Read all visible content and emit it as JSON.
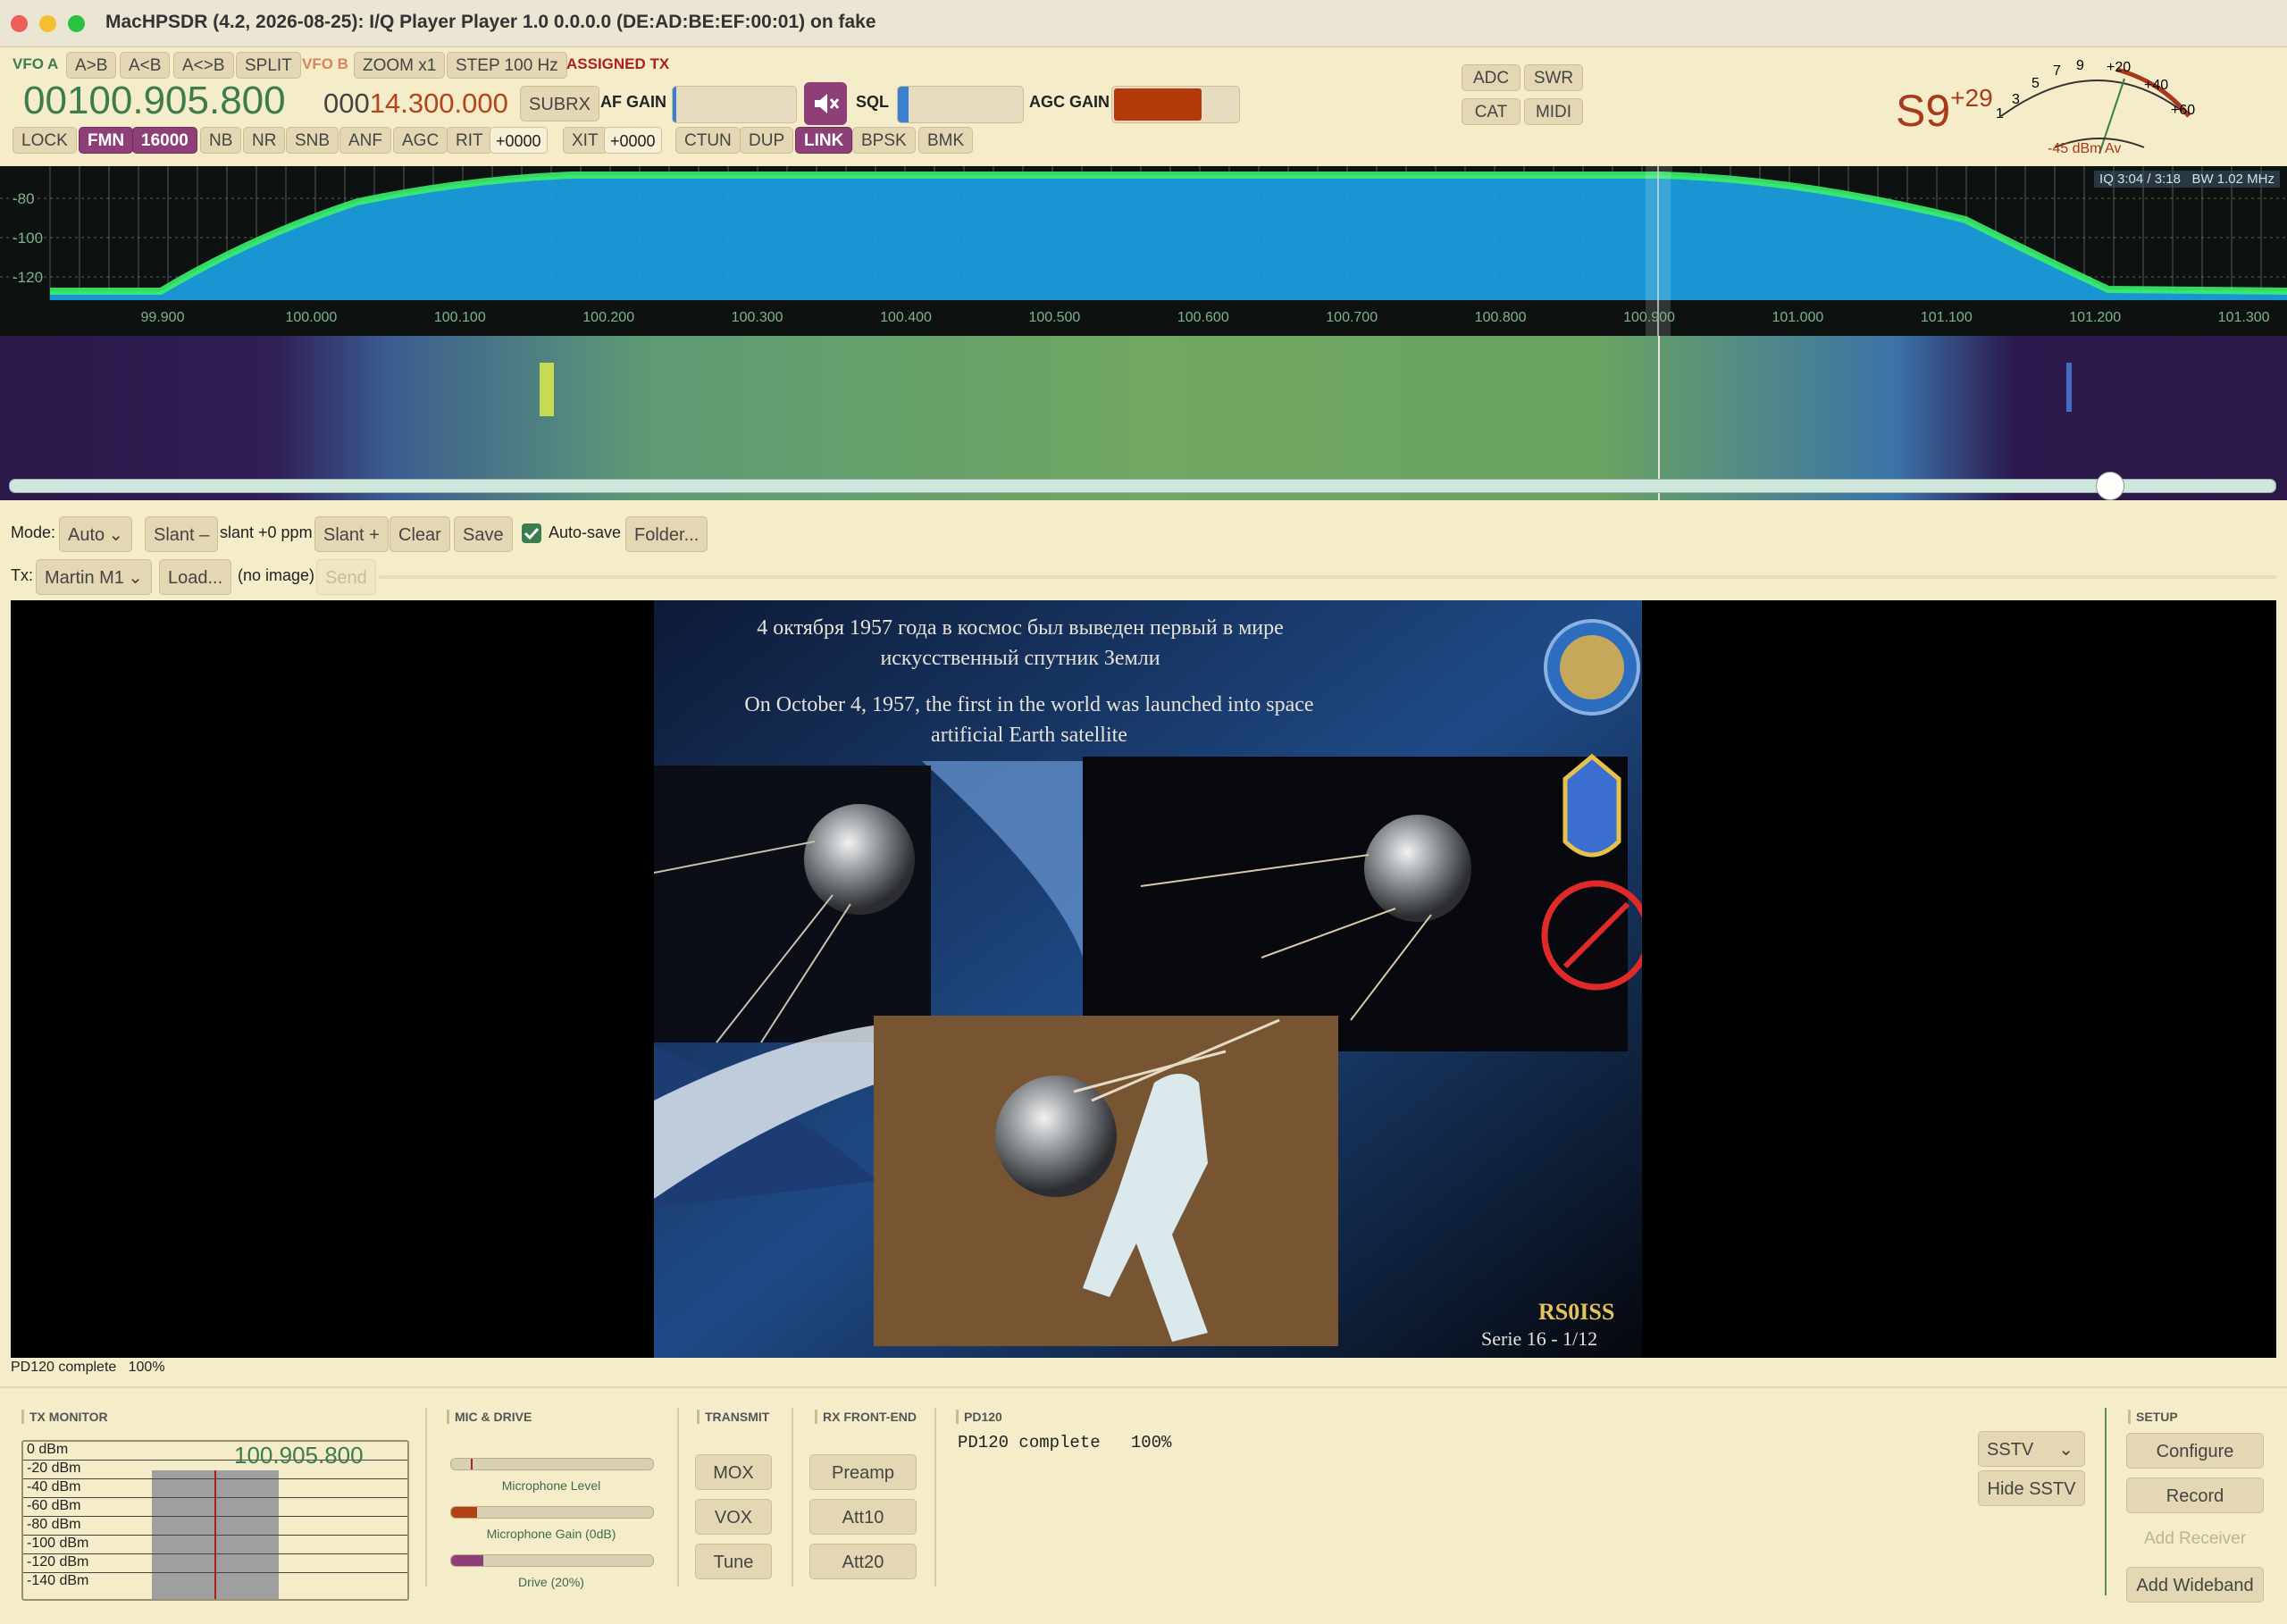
{
  "window": {
    "title": "MacHPSDR (4.2, 2026-08-25): I/Q Player Player 1.0 0.0.0.0 (DE:AD:BE:EF:00:01) on fake"
  },
  "toolbar": {
    "vfo_a": "VFO A",
    "a_to_b": "A>B",
    "a_from_b": "A<B",
    "a_swap_b": "A<>B",
    "split": "SPLIT",
    "vfo_b": "VFO B",
    "zoom": "ZOOM x1",
    "step": "STEP 100 Hz",
    "assigned_tx": "ASSIGNED TX"
  },
  "vfo": {
    "a_freq": "00100.905.800",
    "b_prefix": "000",
    "b_freq": "14.300.000"
  },
  "audio": {
    "subrx": "SUBRX",
    "af_gain": "AF GAIN",
    "sql": "SQL",
    "agc_gain": "AGC GAIN",
    "af_level": 0.02,
    "sql_level": 0.1,
    "agc_level": 0.7
  },
  "rowbtn": {
    "lock": "LOCK",
    "fmn": "FMN",
    "bw": "16000",
    "nb": "NB",
    "nr": "NR",
    "snb": "SNB",
    "anf": "ANF",
    "agc": "AGC",
    "rit": "RIT",
    "rit_val": "+0000",
    "xit": "XIT",
    "xit_val": "+0000",
    "ctun": "CTUN",
    "dup": "DUP",
    "link": "LINK",
    "bpsk": "BPSK",
    "bmk": "BMK"
  },
  "right_btns": {
    "adc": "ADC",
    "swr": "SWR",
    "cat": "CAT",
    "midi": "MIDI"
  },
  "meter": {
    "s_value": "S9",
    "s_over": "+29",
    "avg": "-45 dBm Av",
    "scale": [
      "1",
      "3",
      "5",
      "7",
      "9",
      "+20",
      "+40",
      "+60"
    ]
  },
  "panadapter": {
    "db_labels": [
      "-80",
      "-100",
      "-120"
    ],
    "freq_labels": [
      "99.900",
      "100.000",
      "100.100",
      "100.200",
      "100.300",
      "100.400",
      "100.500",
      "100.600",
      "100.700",
      "100.800",
      "100.900",
      "101.000",
      "101.100",
      "101.200",
      "101.300"
    ],
    "iq_info": "IQ 3:04 / 3:18",
    "bw_info": "BW 1.02 MHz"
  },
  "sstv": {
    "mode_label": "Mode:",
    "mode_value": "Auto",
    "slant_minus": "Slant –",
    "slant_text": "slant +0 ppm",
    "slant_plus": "Slant +",
    "clear": "Clear",
    "save": "Save",
    "autosave": "Auto-save",
    "folder": "Folder...",
    "tx_label": "Tx:",
    "tx_mode": "Martin M1",
    "load": "Load...",
    "no_image": "(no image)",
    "send": "Send",
    "status": "PD120 complete   100%",
    "image_text_ru1": "4 октября 1957 года в космос был выведен первый в мире",
    "image_text_ru2": "искусственный спутник Земли",
    "image_text_en1": "On October 4, 1957, the first in the world was launched into space",
    "image_text_en2": "artificial Earth satellite",
    "image_callsign": "RS0ISS",
    "image_serie": "Serie 16 - 1/12"
  },
  "bottom": {
    "tx_monitor": {
      "title": "TX MONITOR",
      "freq": "100.905.800",
      "levels": [
        "0 dBm",
        "-20 dBm",
        "-40 dBm",
        "-60 dBm",
        "-80 dBm",
        "-100 dBm",
        "-120 dBm",
        "-140 dBm"
      ]
    },
    "mic_drive": {
      "title": "MIC & DRIVE",
      "mic_level": "Microphone Level",
      "mic_gain": "Microphone Gain (0dB)",
      "drive": "Drive (20%)",
      "mic_gain_level": 0.13,
      "drive_level": 0.16
    },
    "transmit": {
      "title": "TRANSMIT",
      "mox": "MOX",
      "vox": "VOX",
      "tune": "Tune"
    },
    "rx_frontend": {
      "title": "RX FRONT-END",
      "preamp": "Preamp",
      "att10": "Att10",
      "att20": "Att20"
    },
    "decoder": {
      "title": "PD120",
      "text": "PD120 complete   100%"
    },
    "sstv_select": "SSTV",
    "hide_sstv": "Hide SSTV",
    "setup": {
      "title": "SETUP",
      "configure": "Configure",
      "record": "Record",
      "add_receiver": "Add Receiver",
      "add_wideband": "Add Wideband"
    }
  },
  "colors": {
    "accent": "#8e3f77",
    "vfo_a": "#3c7d4f",
    "vfo_b": "#b2461a",
    "background": "#f5ecc9"
  }
}
